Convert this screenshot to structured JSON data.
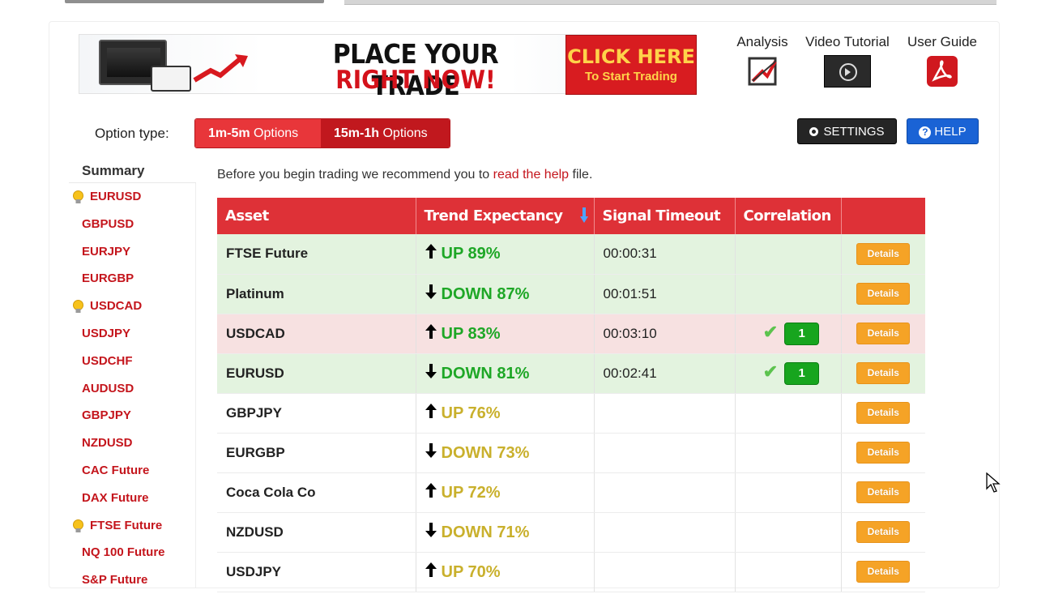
{
  "banner": {
    "headline1": "PLACE YOUR TRADE",
    "headline2": "RIGHT NOW!",
    "cta_line1": "CLICK HERE",
    "cta_line2": "To Start Trading"
  },
  "resources": {
    "analysis": {
      "label": "Analysis",
      "icon": "analysis-icon"
    },
    "video": {
      "label": "Video Tutorial",
      "icon": "play-icon"
    },
    "guide": {
      "label": "User Guide",
      "icon": "pdf-icon"
    }
  },
  "options": {
    "label": "Option type:",
    "btn1_strong": "1m-5m",
    "btn1_rest": " Options",
    "btn2_strong": "15m-1h",
    "btn2_rest": " Options"
  },
  "toolbar": {
    "settings_label": "SETTINGS",
    "help_label": "HELP"
  },
  "sidebar": {
    "title": "Summary",
    "items": [
      {
        "label": "EURUSD",
        "starred": true
      },
      {
        "label": "GBPUSD",
        "starred": false
      },
      {
        "label": "EURJPY",
        "starred": false
      },
      {
        "label": "EURGBP",
        "starred": false
      },
      {
        "label": "USDCAD",
        "starred": true
      },
      {
        "label": "USDJPY",
        "starred": false
      },
      {
        "label": "USDCHF",
        "starred": false
      },
      {
        "label": "AUDUSD",
        "starred": false
      },
      {
        "label": "GBPJPY",
        "starred": false
      },
      {
        "label": "NZDUSD",
        "starred": false
      },
      {
        "label": "CAC Future",
        "starred": false
      },
      {
        "label": "DAX Future",
        "starred": false
      },
      {
        "label": "FTSE Future",
        "starred": true
      },
      {
        "label": "NQ 100 Future",
        "starred": false
      },
      {
        "label": "S&P Future",
        "starred": false
      }
    ]
  },
  "intro": {
    "before": "Before you begin trading we recommend you to ",
    "link": "read the help",
    "after": " file."
  },
  "table": {
    "headers": [
      "Asset",
      "Trend Expectancy",
      "Signal Timeout",
      "Correlation",
      ""
    ],
    "details_label": "Details",
    "rows": [
      {
        "asset": "FTSE Future",
        "dir": "up",
        "trend": "UP 89%",
        "timeout": "00:00:31",
        "correlation": "",
        "highlight": "green",
        "color": "green"
      },
      {
        "asset": "Platinum",
        "dir": "down",
        "trend": "DOWN 87%",
        "timeout": "00:01:51",
        "correlation": "",
        "highlight": "green",
        "color": "green"
      },
      {
        "asset": "USDCAD",
        "dir": "up",
        "trend": "UP 83%",
        "timeout": "00:03:10",
        "correlation": "1",
        "highlight": "pink",
        "color": "green"
      },
      {
        "asset": "EURUSD",
        "dir": "down",
        "trend": "DOWN 81%",
        "timeout": "00:02:41",
        "correlation": "1",
        "highlight": "green",
        "color": "green"
      },
      {
        "asset": "GBPJPY",
        "dir": "up",
        "trend": "UP 76%",
        "timeout": "",
        "correlation": "",
        "highlight": "none",
        "color": "olive"
      },
      {
        "asset": "EURGBP",
        "dir": "down",
        "trend": "DOWN 73%",
        "timeout": "",
        "correlation": "",
        "highlight": "none",
        "color": "olive"
      },
      {
        "asset": "Coca Cola Co",
        "dir": "up",
        "trend": "UP 72%",
        "timeout": "",
        "correlation": "",
        "highlight": "none",
        "color": "olive"
      },
      {
        "asset": "NZDUSD",
        "dir": "down",
        "trend": "DOWN 71%",
        "timeout": "",
        "correlation": "",
        "highlight": "none",
        "color": "olive"
      },
      {
        "asset": "USDJPY",
        "dir": "up",
        "trend": "UP 70%",
        "timeout": "",
        "correlation": "",
        "highlight": "none",
        "color": "olive"
      }
    ]
  },
  "colors": {
    "brand_red": "#de3137",
    "up_strong": "#1ea726",
    "weak": "#c9b02c",
    "details_orange": "#f5a326",
    "help_blue": "#1a63d5"
  }
}
